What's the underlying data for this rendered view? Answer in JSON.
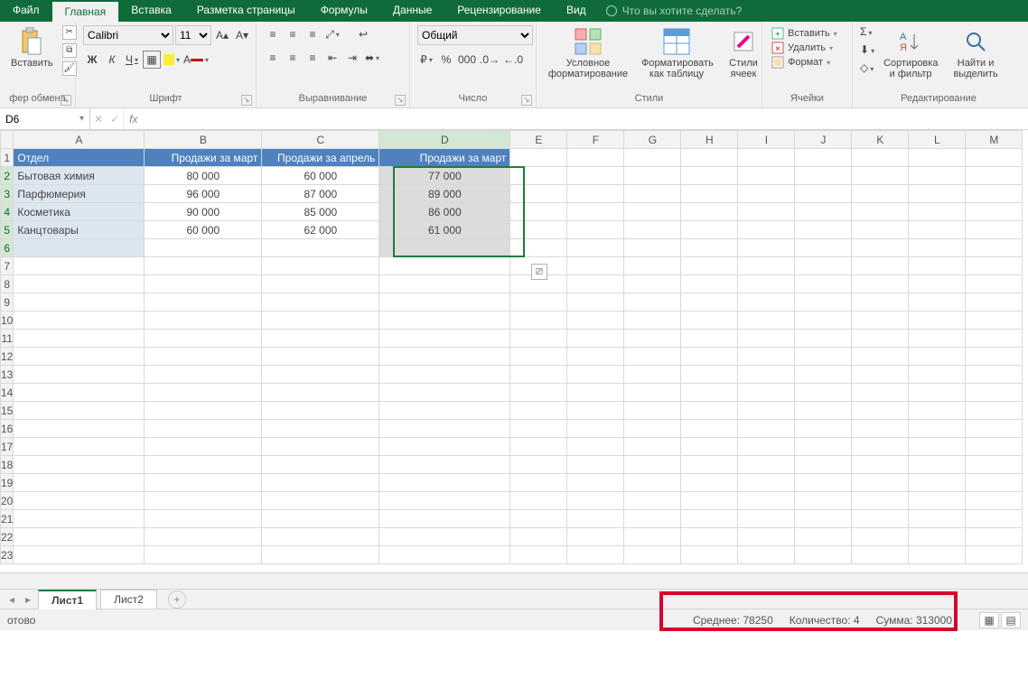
{
  "menubar": {
    "file": "Файл",
    "home": "Главная",
    "insert": "Вставка",
    "page_layout": "Разметка страницы",
    "formulas": "Формулы",
    "data": "Данные",
    "review": "Рецензирование",
    "view": "Вид",
    "tell_me_placeholder": "Что вы хотите сделать?"
  },
  "ribbon": {
    "clipboard": {
      "paste": "Вставить",
      "title": "фер обмена"
    },
    "font": {
      "name": "Calibri",
      "size": "11",
      "title": "Шрифт",
      "bold": "Ж",
      "italic": "К",
      "underline": "Ч"
    },
    "alignment": {
      "title": "Выравнивание"
    },
    "number": {
      "format": "Общий",
      "title": "Число"
    },
    "styles": {
      "cond_fmt": "Условное форматирование",
      "as_table": "Форматировать как таблицу",
      "cell_styles": "Стили ячеек",
      "title": "Стили"
    },
    "cells": {
      "insert": "Вставить",
      "delete": "Удалить",
      "format": "Формат",
      "title": "Ячейки"
    },
    "editing": {
      "sort": "Сортировка и фильтр",
      "find": "Найти и выделить",
      "title": "Редактирование"
    }
  },
  "namebox": "D6",
  "columns": [
    "A",
    "B",
    "C",
    "D",
    "E",
    "F",
    "G",
    "H",
    "I",
    "J",
    "K",
    "L",
    "M"
  ],
  "headers": {
    "A": "Отдел",
    "B": "Продажи за март",
    "C": "Продажи за апрель",
    "D": "Продажи за март"
  },
  "rows": [
    {
      "A": "Бытовая химия",
      "B": "80 000",
      "C": "60 000",
      "D": "77 000"
    },
    {
      "A": "Парфюмерия",
      "B": "96 000",
      "C": "87 000",
      "D": "89 000"
    },
    {
      "A": "Косметика",
      "B": "90 000",
      "C": "85 000",
      "D": "86 000"
    },
    {
      "A": "Канцтовары",
      "B": "60 000",
      "C": "62 000",
      "D": "61 000"
    }
  ],
  "sheets": {
    "s1": "Лист1",
    "s2": "Лист2"
  },
  "statusbar": {
    "ready": "отово",
    "avg_label": "Среднее:",
    "avg_val": "78250",
    "count_label": "Количество:",
    "count_val": "4",
    "sum_label": "Сумма:",
    "sum_val": "313000"
  }
}
